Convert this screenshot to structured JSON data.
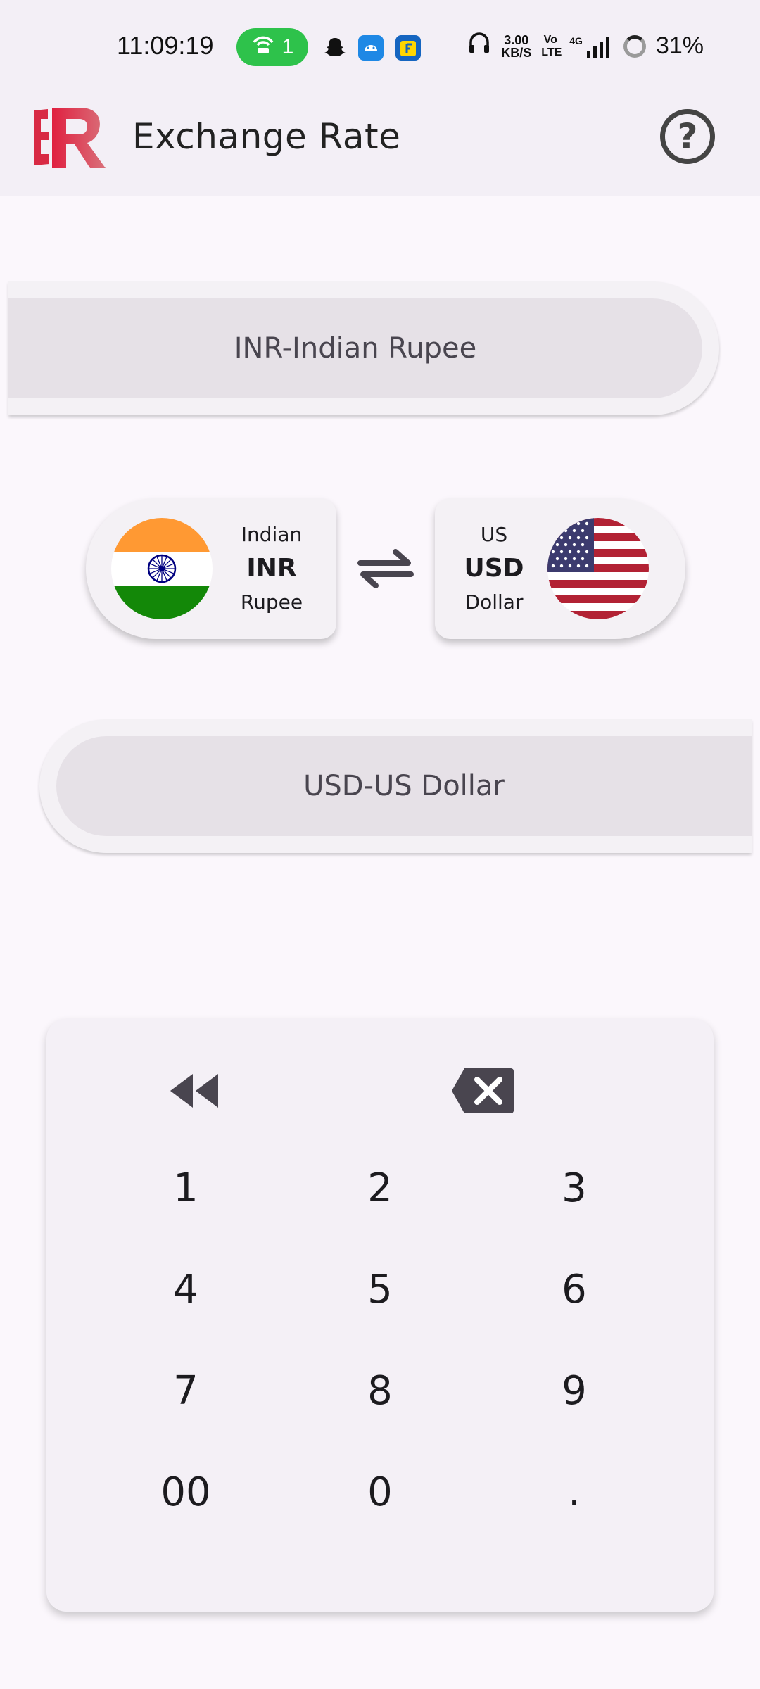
{
  "status_bar": {
    "time": "11:09:19",
    "hotspot_count": "1",
    "net_speed_value": "3.00",
    "net_speed_unit": "KB/S",
    "volte": "Vo LTE",
    "network": "4G",
    "battery": "31%"
  },
  "app_bar": {
    "title": "Exchange Rate",
    "help_label": "?"
  },
  "from_selector": {
    "label": "INR-Indian Rupee"
  },
  "to_selector": {
    "label": "USD-US Dollar"
  },
  "from_currency": {
    "name_line1": "Indian",
    "code": "INR",
    "name_line2": "Rupee",
    "flag": "india-flag"
  },
  "to_currency": {
    "name_line1": "US",
    "code": "USD",
    "name_line2": "Dollar",
    "flag": "usa-flag"
  },
  "keypad": {
    "keys": [
      "1",
      "2",
      "3",
      "4",
      "5",
      "6",
      "7",
      "8",
      "9",
      "00",
      "0",
      "."
    ],
    "clear_icon": "rewind-icon",
    "backspace_icon": "backspace-icon"
  },
  "colors": {
    "hotspot_green": "#2ec24b",
    "logo_red": "#d83a4a",
    "saffron": "#ff9933",
    "india_green": "#138808"
  }
}
